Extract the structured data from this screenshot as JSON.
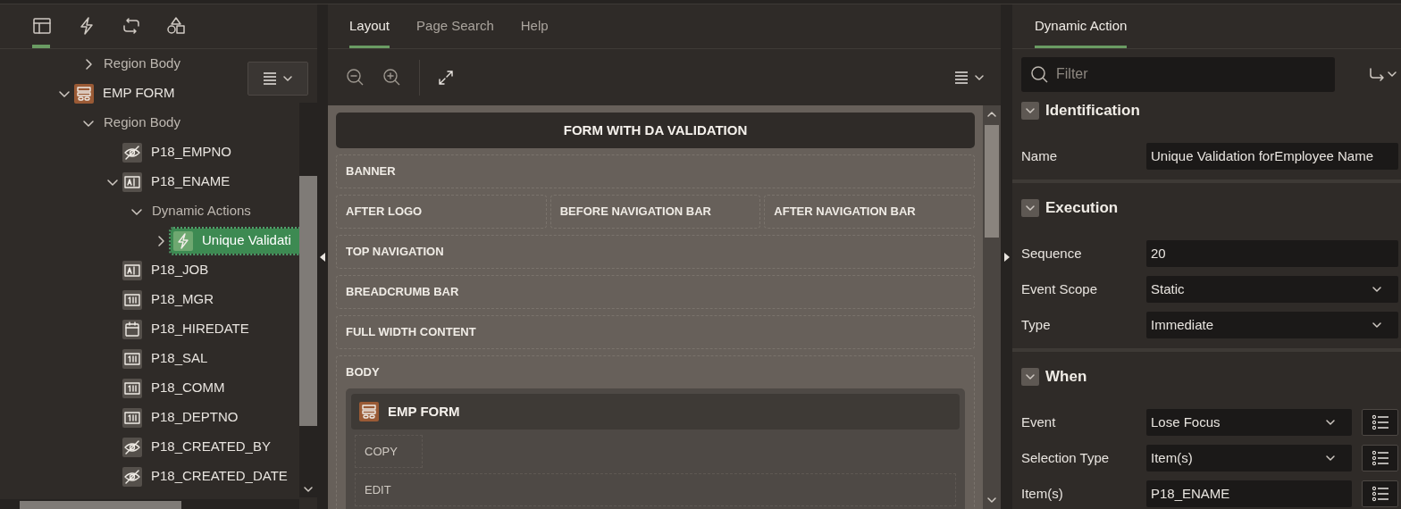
{
  "left_panel": {
    "tabs": [
      {
        "selected": true
      },
      {
        "selected": false
      },
      {
        "selected": false
      },
      {
        "selected": false
      }
    ],
    "tree": [
      {
        "label": "Region Body",
        "kind": "group",
        "expanded": false,
        "selected": false
      },
      {
        "label": "EMP FORM",
        "kind": "region",
        "expanded": true,
        "selected": false,
        "children": [
          {
            "label": "Region Body",
            "kind": "group",
            "expanded": true,
            "selected": false,
            "children": [
              {
                "label": "P18_EMPNO",
                "kind": "hidden",
                "selected": false
              },
              {
                "label": "P18_ENAME",
                "kind": "text",
                "expanded": true,
                "selected": false,
                "children": [
                  {
                    "label": "Dynamic Actions",
                    "kind": "group",
                    "expanded": true,
                    "selected": false,
                    "children": [
                      {
                        "label": "Unique Validati",
                        "kind": "action",
                        "expanded": false,
                        "selected": true
                      }
                    ]
                  }
                ]
              },
              {
                "label": "P18_JOB",
                "kind": "text",
                "selected": false
              },
              {
                "label": "P18_MGR",
                "kind": "number",
                "selected": false
              },
              {
                "label": "P18_HIREDATE",
                "kind": "date",
                "selected": false
              },
              {
                "label": "P18_SAL",
                "kind": "number",
                "selected": false
              },
              {
                "label": "P18_COMM",
                "kind": "number",
                "selected": false
              },
              {
                "label": "P18_DEPTNO",
                "kind": "number",
                "selected": false
              },
              {
                "label": "P18_CREATED_BY",
                "kind": "hidden",
                "selected": false
              },
              {
                "label": "P18_CREATED_DATE",
                "kind": "hidden",
                "selected": false
              }
            ]
          }
        ]
      }
    ]
  },
  "center_panel": {
    "tabs": [
      {
        "label": "Layout",
        "selected": true
      },
      {
        "label": "Page Search",
        "selected": false
      },
      {
        "label": "Help",
        "selected": false
      }
    ],
    "page_title": "FORM WITH DA VALIDATION",
    "positions": [
      {
        "kind": "single",
        "label": "BANNER"
      },
      {
        "kind": "split",
        "labels": [
          "AFTER LOGO",
          "BEFORE NAVIGATION BAR",
          "AFTER NAVIGATION BAR"
        ]
      },
      {
        "kind": "single",
        "label": "TOP NAVIGATION"
      },
      {
        "kind": "single",
        "label": "BREADCRUMB BAR"
      },
      {
        "kind": "single",
        "label": "FULL WIDTH CONTENT"
      },
      {
        "kind": "body",
        "label": "BODY",
        "region": {
          "title": "EMP FORM",
          "slots": [
            "COPY",
            "EDIT"
          ]
        }
      }
    ]
  },
  "right_panel": {
    "tabs": [
      {
        "label": "Dynamic Action",
        "selected": true
      }
    ],
    "filter": {
      "placeholder": "Filter"
    },
    "sections": [
      {
        "title": "Identification",
        "expanded": true,
        "properties": [
          {
            "label": "Name",
            "kind": "text",
            "value": "Unique Validation forEmployee Name"
          }
        ]
      },
      {
        "title": "Execution",
        "expanded": true,
        "properties": [
          {
            "label": "Sequence",
            "kind": "text",
            "value": "20"
          },
          {
            "label": "Event Scope",
            "kind": "select",
            "value": "Static"
          },
          {
            "label": "Type",
            "kind": "select",
            "value": "Immediate"
          }
        ]
      },
      {
        "title": "When",
        "expanded": true,
        "properties": [
          {
            "label": "Event",
            "kind": "select",
            "value": "Lose Focus",
            "list_button": true
          },
          {
            "label": "Selection Type",
            "kind": "select",
            "value": "Item(s)",
            "list_button": true
          },
          {
            "label": "Item(s)",
            "kind": "text",
            "value": "P18_ENAME",
            "list_button": true
          }
        ]
      }
    ]
  }
}
